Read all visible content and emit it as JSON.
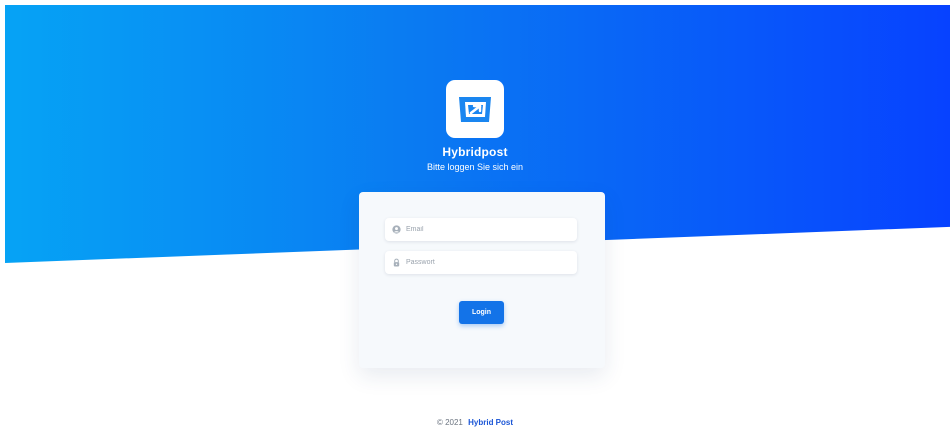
{
  "brand": {
    "name": "Hybridpost",
    "subtitle": "Bitte loggen Sie sich ein",
    "logo_icon": "mail-arrow-icon"
  },
  "login_form": {
    "email": {
      "placeholder": "Email",
      "value": "",
      "icon": "user-icon"
    },
    "password": {
      "placeholder": "Passwort",
      "value": "",
      "icon": "lock-icon"
    },
    "submit_label": "Login"
  },
  "footer": {
    "copyright": "© 2021",
    "link_text": "Hybrid Post"
  },
  "colors": {
    "gradient_start": "#06a3f5",
    "gradient_end": "#0742ff",
    "button": "#1373e8",
    "footer_link": "#1a55d6"
  }
}
